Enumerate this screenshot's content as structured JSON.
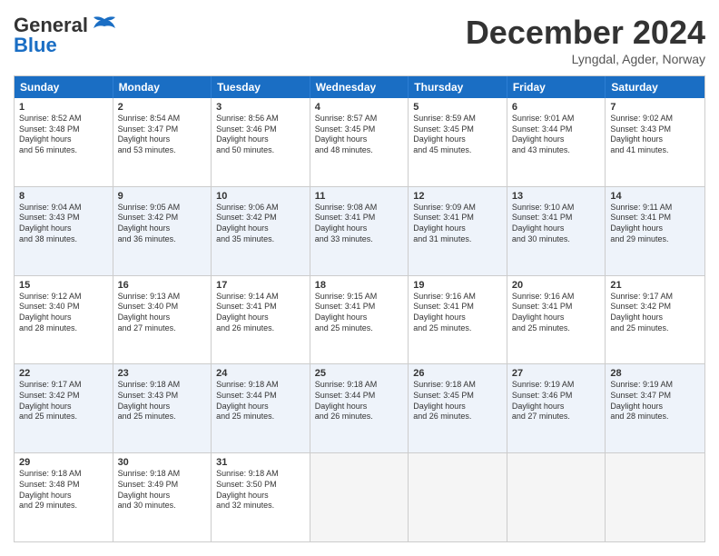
{
  "logo": {
    "line1": "General",
    "line2": "Blue"
  },
  "title": "December 2024",
  "subtitle": "Lyngdal, Agder, Norway",
  "days": [
    "Sunday",
    "Monday",
    "Tuesday",
    "Wednesday",
    "Thursday",
    "Friday",
    "Saturday"
  ],
  "weeks": [
    [
      {
        "day": "1",
        "sunrise": "8:52 AM",
        "sunset": "3:48 PM",
        "daylight": "6 hours and 56 minutes."
      },
      {
        "day": "2",
        "sunrise": "8:54 AM",
        "sunset": "3:47 PM",
        "daylight": "6 hours and 53 minutes."
      },
      {
        "day": "3",
        "sunrise": "8:56 AM",
        "sunset": "3:46 PM",
        "daylight": "6 hours and 50 minutes."
      },
      {
        "day": "4",
        "sunrise": "8:57 AM",
        "sunset": "3:45 PM",
        "daylight": "6 hours and 48 minutes."
      },
      {
        "day": "5",
        "sunrise": "8:59 AM",
        "sunset": "3:45 PM",
        "daylight": "6 hours and 45 minutes."
      },
      {
        "day": "6",
        "sunrise": "9:01 AM",
        "sunset": "3:44 PM",
        "daylight": "6 hours and 43 minutes."
      },
      {
        "day": "7",
        "sunrise": "9:02 AM",
        "sunset": "3:43 PM",
        "daylight": "6 hours and 41 minutes."
      }
    ],
    [
      {
        "day": "8",
        "sunrise": "9:04 AM",
        "sunset": "3:43 PM",
        "daylight": "6 hours and 38 minutes."
      },
      {
        "day": "9",
        "sunrise": "9:05 AM",
        "sunset": "3:42 PM",
        "daylight": "6 hours and 36 minutes."
      },
      {
        "day": "10",
        "sunrise": "9:06 AM",
        "sunset": "3:42 PM",
        "daylight": "6 hours and 35 minutes."
      },
      {
        "day": "11",
        "sunrise": "9:08 AM",
        "sunset": "3:41 PM",
        "daylight": "6 hours and 33 minutes."
      },
      {
        "day": "12",
        "sunrise": "9:09 AM",
        "sunset": "3:41 PM",
        "daylight": "6 hours and 31 minutes."
      },
      {
        "day": "13",
        "sunrise": "9:10 AM",
        "sunset": "3:41 PM",
        "daylight": "6 hours and 30 minutes."
      },
      {
        "day": "14",
        "sunrise": "9:11 AM",
        "sunset": "3:41 PM",
        "daylight": "6 hours and 29 minutes."
      }
    ],
    [
      {
        "day": "15",
        "sunrise": "9:12 AM",
        "sunset": "3:40 PM",
        "daylight": "6 hours and 28 minutes."
      },
      {
        "day": "16",
        "sunrise": "9:13 AM",
        "sunset": "3:40 PM",
        "daylight": "6 hours and 27 minutes."
      },
      {
        "day": "17",
        "sunrise": "9:14 AM",
        "sunset": "3:41 PM",
        "daylight": "6 hours and 26 minutes."
      },
      {
        "day": "18",
        "sunrise": "9:15 AM",
        "sunset": "3:41 PM",
        "daylight": "6 hours and 25 minutes."
      },
      {
        "day": "19",
        "sunrise": "9:16 AM",
        "sunset": "3:41 PM",
        "daylight": "6 hours and 25 minutes."
      },
      {
        "day": "20",
        "sunrise": "9:16 AM",
        "sunset": "3:41 PM",
        "daylight": "6 hours and 25 minutes."
      },
      {
        "day": "21",
        "sunrise": "9:17 AM",
        "sunset": "3:42 PM",
        "daylight": "6 hours and 25 minutes."
      }
    ],
    [
      {
        "day": "22",
        "sunrise": "9:17 AM",
        "sunset": "3:42 PM",
        "daylight": "6 hours and 25 minutes."
      },
      {
        "day": "23",
        "sunrise": "9:18 AM",
        "sunset": "3:43 PM",
        "daylight": "6 hours and 25 minutes."
      },
      {
        "day": "24",
        "sunrise": "9:18 AM",
        "sunset": "3:44 PM",
        "daylight": "6 hours and 25 minutes."
      },
      {
        "day": "25",
        "sunrise": "9:18 AM",
        "sunset": "3:44 PM",
        "daylight": "6 hours and 26 minutes."
      },
      {
        "day": "26",
        "sunrise": "9:18 AM",
        "sunset": "3:45 PM",
        "daylight": "6 hours and 26 minutes."
      },
      {
        "day": "27",
        "sunrise": "9:19 AM",
        "sunset": "3:46 PM",
        "daylight": "6 hours and 27 minutes."
      },
      {
        "day": "28",
        "sunrise": "9:19 AM",
        "sunset": "3:47 PM",
        "daylight": "6 hours and 28 minutes."
      }
    ],
    [
      {
        "day": "29",
        "sunrise": "9:18 AM",
        "sunset": "3:48 PM",
        "daylight": "6 hours and 29 minutes."
      },
      {
        "day": "30",
        "sunrise": "9:18 AM",
        "sunset": "3:49 PM",
        "daylight": "6 hours and 30 minutes."
      },
      {
        "day": "31",
        "sunrise": "9:18 AM",
        "sunset": "3:50 PM",
        "daylight": "6 hours and 32 minutes."
      },
      null,
      null,
      null,
      null
    ]
  ]
}
